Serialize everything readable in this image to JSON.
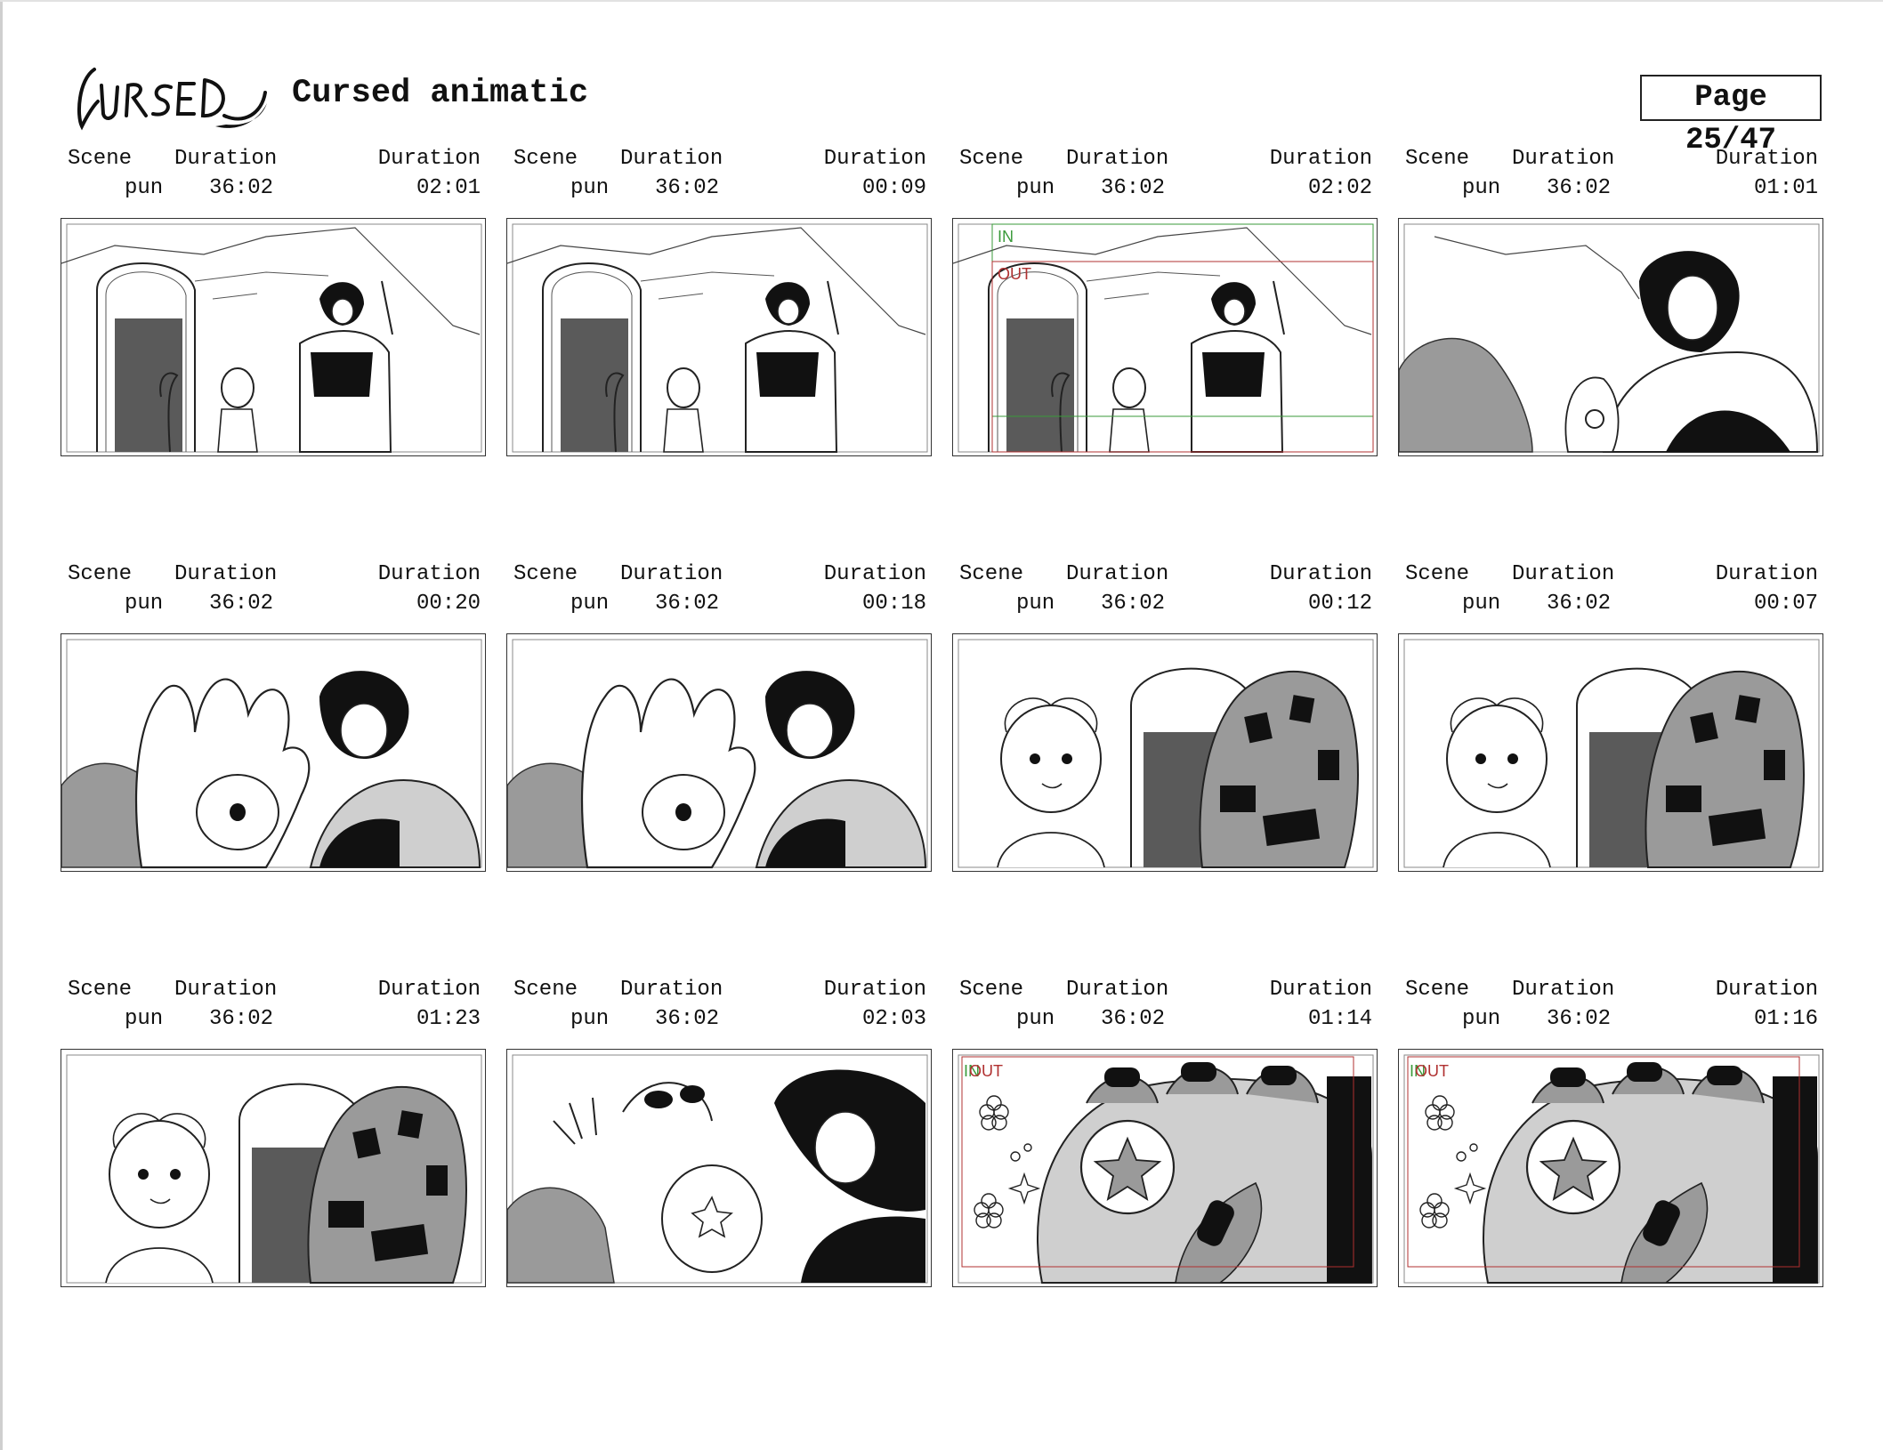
{
  "header": {
    "logo_text": "CURSED",
    "title": "Cursed animatic",
    "page_label": "Page 25/47"
  },
  "labels": {
    "scene": "Scene",
    "duration": "Duration"
  },
  "panels": [
    {
      "scene": "pun",
      "total": "36:02",
      "duration": "02:01",
      "kind": "arch-group",
      "tags": []
    },
    {
      "scene": "pun",
      "total": "36:02",
      "duration": "00:09",
      "kind": "arch-group",
      "tags": []
    },
    {
      "scene": "pun",
      "total": "36:02",
      "duration": "02:02",
      "kind": "arch-group",
      "tags": [
        "IN",
        "OUT"
      ]
    },
    {
      "scene": "pun",
      "total": "36:02",
      "duration": "01:01",
      "kind": "closeup",
      "tags": []
    },
    {
      "scene": "pun",
      "total": "36:02",
      "duration": "00:20",
      "kind": "hand-eye",
      "tags": []
    },
    {
      "scene": "pun",
      "total": "36:02",
      "duration": "00:18",
      "kind": "hand-eye",
      "tags": []
    },
    {
      "scene": "pun",
      "total": "36:02",
      "duration": "00:12",
      "kind": "kid-hand",
      "tags": []
    },
    {
      "scene": "pun",
      "total": "36:02",
      "duration": "00:07",
      "kind": "kid-hand",
      "tags": []
    },
    {
      "scene": "pun",
      "total": "36:02",
      "duration": "01:23",
      "kind": "kid-hand",
      "tags": []
    },
    {
      "scene": "pun",
      "total": "36:02",
      "duration": "02:03",
      "kind": "hug",
      "tags": []
    },
    {
      "scene": "pun",
      "total": "36:02",
      "duration": "01:14",
      "kind": "star-hand",
      "tags": [
        "IN",
        "OUT"
      ]
    },
    {
      "scene": "pun",
      "total": "36:02",
      "duration": "01:16",
      "kind": "star-hand",
      "tags": [
        "IN",
        "OUT"
      ]
    }
  ],
  "colors": {
    "tag_in": "#3a9a3a",
    "tag_out": "#b03030",
    "ink": "#111111",
    "grey_dark": "#5a5a5a",
    "grey_mid": "#9a9a9a",
    "grey_light": "#cfcfcf"
  }
}
